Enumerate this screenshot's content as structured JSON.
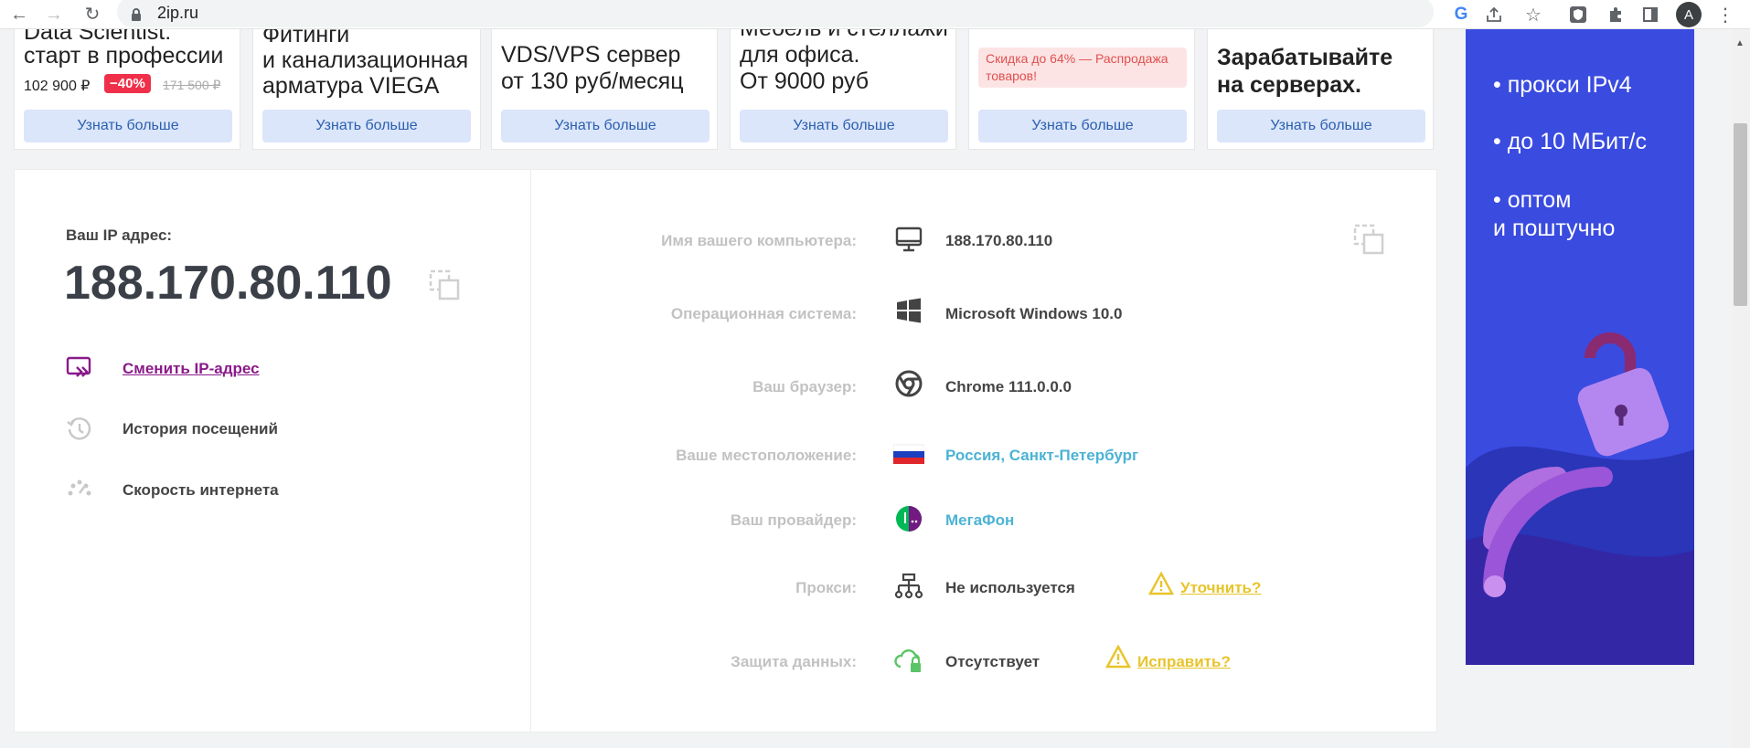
{
  "browser": {
    "url": "2ip.ru",
    "avatar_letter": "A"
  },
  "top_ads": [
    {
      "line1": "Data Scientist:",
      "line2": "старт в профессии",
      "price": "102 900 ₽",
      "discount": "−40%",
      "old_price": "171 500 ₽",
      "button": "Узнать больше"
    },
    {
      "line1": "Фитинги",
      "line2": "и канализационная",
      "line3": "арматура VIEGA",
      "button": "Узнать больше"
    },
    {
      "line1": "VDS/VPS сервер",
      "line2": "от 130 руб/месяц",
      "button": "Узнать больше"
    },
    {
      "line1": "Мебель и стеллажи",
      "line2": "для офиса.",
      "line3": "От 9000 руб",
      "button": "Узнать больше"
    },
    {
      "badge": "Скидка до 64% — Распродажа товаров!",
      "button": "Узнать больше"
    },
    {
      "line1": "Зарабатывайте",
      "line2": "на серверах.",
      "button": "Узнать больше"
    }
  ],
  "ip_panel": {
    "label": "Ваш IP адрес:",
    "ip": "188.170.80.110",
    "links": [
      {
        "label": "Сменить IP-адрес"
      },
      {
        "label": "История посещений"
      },
      {
        "label": "Скорость интернета"
      }
    ]
  },
  "info_rows": [
    {
      "label": "Имя вашего компьютера:",
      "value": "188.170.80.110",
      "icon": "monitor-icon"
    },
    {
      "label": "Операционная система:",
      "value": "Microsoft Windows 10.0",
      "icon": "windows-icon"
    },
    {
      "label": "Ваш браузер:",
      "value": "Chrome 111.0.0.0",
      "icon": "chrome-icon"
    },
    {
      "label": "Ваше местоположение:",
      "value": "Россия, Санкт-Петербург",
      "icon": "russia-flag-icon"
    },
    {
      "label": "Ваш провайдер:",
      "value": "МегаФон",
      "icon": "megafon-icon"
    },
    {
      "label": "Прокси:",
      "value": "Не используется",
      "icon": "network-icon",
      "action": "Уточнить?"
    },
    {
      "label": "Защита данных:",
      "value": "Отсутствует",
      "icon": "cloud-lock-icon",
      "action": "Исправить?"
    }
  ],
  "right_ad": {
    "items": [
      "• прокси IPv4",
      "• до 10 МБит/с",
      "• оптом",
      "и поштучно"
    ]
  },
  "colors": {
    "link_purple": "#8a1a8a",
    "link_blue": "#4cb3d4",
    "warn_yellow": "#e8c42a",
    "ad_blue": "#3a4be0"
  }
}
